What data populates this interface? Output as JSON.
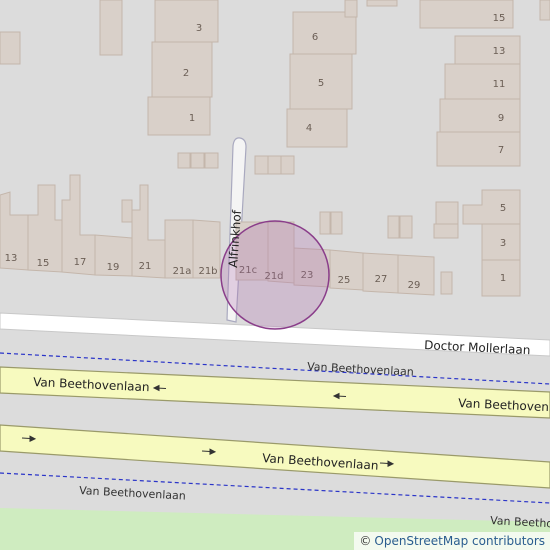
{
  "map": {
    "streets": {
      "doctor_mollerlaan": "Doctor Mollerlaan",
      "van_beethovenlaan": "Van Beethovenlaan",
      "alfrinkhof": "Alfrinkhof"
    },
    "house_numbers": {
      "n15": "15",
      "n13": "13",
      "n11": "11",
      "n9": "9",
      "n7": "7",
      "n3": "3",
      "n2": "2",
      "n1": "1",
      "n6": "6",
      "n5": "5",
      "n4": "4",
      "r13": "13",
      "r15": "15",
      "r17": "17",
      "r19": "19",
      "r21": "21",
      "r21a": "21a",
      "r21b": "21b",
      "r21c": "21c",
      "r21d": "21d",
      "r23": "23",
      "r25": "25",
      "r27": "27",
      "r29": "29",
      "e5": "5",
      "e3": "3",
      "e1": "1"
    },
    "colors": {
      "background": "#dcdcdc",
      "building": "#d9d0c9",
      "trunk_road": "#f7fabf",
      "highlight_circle": "#b070b0"
    }
  },
  "attribution": {
    "symbol": "©",
    "link_text": "OpenStreetMap contributors"
  }
}
